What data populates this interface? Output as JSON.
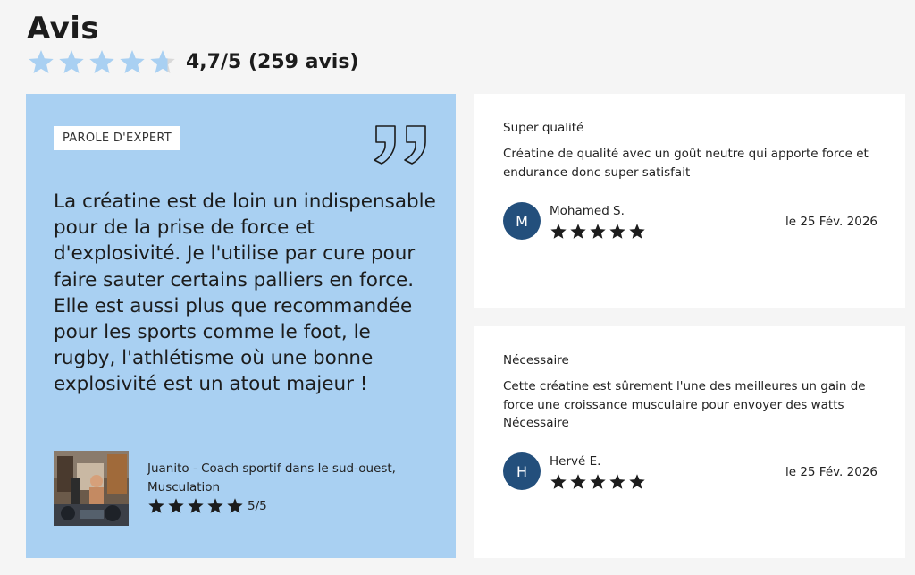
{
  "header": {
    "title": "Avis",
    "average": "4,7/5 (259 avis)",
    "average_value": 4.7,
    "star_color": "#a9d0f2",
    "star_empty_color": "#d9d9d9"
  },
  "expert": {
    "badge": "PAROLE D'EXPERT",
    "quote": "La créatine est de loin un indispensable pour de la prise de force et d'explosivité. Je l'utilise par cure pour faire sauter certains palliers en force. Elle est aussi plus que recommandée pour les sports comme le foot, le rugby, l'athlétisme où une bonne explosivité est un atout majeur !",
    "author": "Juanito - Coach sportif dans le sud-ouest, Musculation",
    "rating": "5/5",
    "rating_value": 5,
    "background": "#a9d0f2"
  },
  "reviews": [
    {
      "title": "Super qualité",
      "body": "Créatine de qualité avec un goût neutre qui apporte force et endurance donc super satisfait",
      "initial": "M",
      "name": "Mohamed S.",
      "stars": 5,
      "date": "le  25 Fév. 2026"
    },
    {
      "title": "Nécessaire",
      "body": "Cette créatine est sûrement l'une des meilleures un gain de force une croissance musculaire pour envoyer des watts Nécessaire",
      "initial": "H",
      "name": "Hervé E.",
      "stars": 5,
      "date": "le  25 Fév. 2026"
    }
  ],
  "colors": {
    "avatar": "#234f7c",
    "star_dark": "#1c1c1c"
  }
}
